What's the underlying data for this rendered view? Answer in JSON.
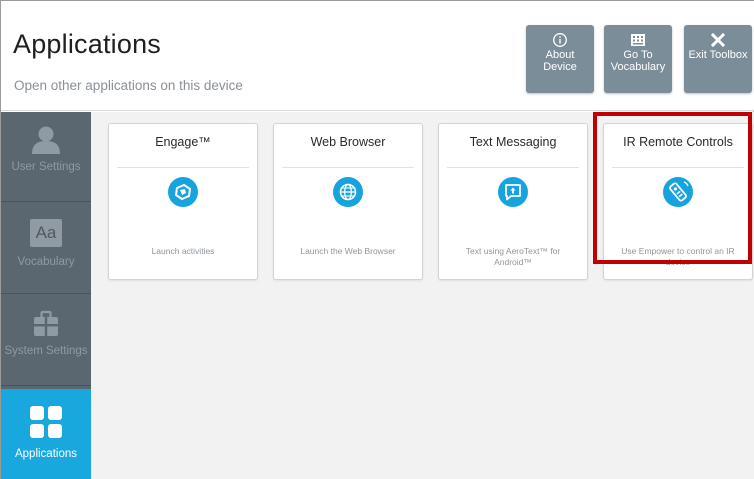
{
  "header": {
    "title": "Applications",
    "subtitle": "Open other applications on this device",
    "buttons": [
      {
        "id": "about",
        "icon": "info-icon",
        "label": "About Device"
      },
      {
        "id": "vocab",
        "icon": "keyboard-icon",
        "label": "Go To Vocabulary"
      },
      {
        "id": "exit",
        "icon": "close-icon",
        "label": "Exit Toolbox"
      }
    ]
  },
  "sidebar": {
    "items": [
      {
        "label": "User Settings",
        "icon": "user-icon",
        "active": false
      },
      {
        "label": "Vocabulary",
        "icon": "aa-icon",
        "active": false
      },
      {
        "label": "System Settings",
        "icon": "briefcase-icon",
        "active": false
      },
      {
        "label": "Applications",
        "icon": "grid-icon",
        "active": true
      }
    ]
  },
  "cards": [
    {
      "title": "Engage™",
      "icon": "engage-icon",
      "description": "Launch activities"
    },
    {
      "title": "Web Browser",
      "icon": "globe-icon",
      "description": "Launch the Web Browser"
    },
    {
      "title": "Text Messaging",
      "icon": "message-icon",
      "description": "Text using AeroText™ for Android™"
    },
    {
      "title": "IR Remote Controls",
      "icon": "remote-icon",
      "description": "Use Empower to control an IR device"
    }
  ],
  "colors": {
    "accent": "#19a8de",
    "sidebar": "#5a6670",
    "header_button": "#7b8d99",
    "highlight": "#c00000"
  }
}
